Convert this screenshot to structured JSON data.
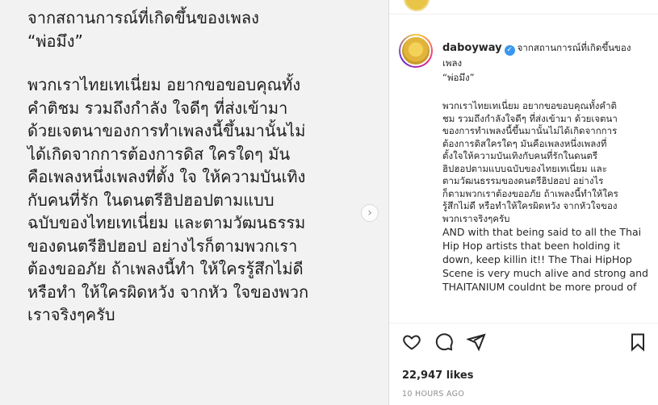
{
  "image": {
    "heading": "จากสถานการณ์ที่เกิดขึ้นของเพลง\n“พ่อมึง”",
    "body_lines": "พวกเราไทยเทเนี่ยม อยากขอขอบคุณทั้ง\nคำติชม รวมถึงกำลัง ใจดีๆ ที่ส่งเข้ามา\nด้วยเจตนาของการทำเพลงนี้ขึ้นมานั้นไม่\nได้เกิดจากการต้องการดิส ใครใดๆ มัน\nคือเพลงหนึ่งเพลงที่ตั้ง ใจ ให้ความบันเทิง\nกับคนที่รัก ในดนตรีฮิปฮอปตามแบบ\nฉบับของไทยเทเนี่ยม และตามวัฒนธรรม\nของดนตรีฮิปฮอป อย่างไรก็ตามพวกเรา\nต้องขออภัย ถ้าเพลงนี้ทำ ให้ใครรู้สึกไม่ดี\nหรือทำ ให้ใครผิดหวัง จากหัว ใจของพวก\nเราจริงๆครับ",
    "next_icon": "chevron-right-icon"
  },
  "caption": {
    "username": "daboyway",
    "verified_icon": "verified-badge-icon",
    "heading": "จากสถานการณ์ที่เกิดขึ้นของ\nเพลง\n“พ่อมึง”",
    "thai_body": "พวกเราไทยเทเนี่ยม อยากขอขอบคุณทั้งคำติ\nชม รวมถึงกำลังใจดีๆ ที่ส่งเข้ามา ด้วยเจตนา\nของการทำเพลงนี้ขึ้นมานั้นไม่ได้เกิดจากการ\nต้องการดิสใครใดๆ มันคือเพลงหนึ่งเพลงที่\nตั้งใจให้ความบันเทิงกับคนที่รักในดนตรี\nฮิปฮอปตามแบบฉบับของไทยเทเนี่ยม และ\nตามวัฒนธรรมของดนตรีฮิปฮอป อย่างไร\nก็ตามพวกเราต้องขออภัย ถ้าเพลงนี้ทำให้ใคร\nรู้สึกไม่ดี หรือทำให้ใครผิดหวัง จากหัวใจของ\nพวกเราจริงๆครับ",
    "english_body": "AND with that being said to all the Thai\nHip Hop artists that been holding it\ndown, keep killin it!! The Thai HipHop\nScene is very much alive and strong and\nTHAITANIUM couldnt be more proud of"
  },
  "actions": {
    "like_icon": "heart-icon",
    "comment_icon": "comment-icon",
    "share_icon": "share-icon",
    "save_icon": "bookmark-icon"
  },
  "likes": "22,947 likes",
  "timestamp": "10 HOURS AGO"
}
